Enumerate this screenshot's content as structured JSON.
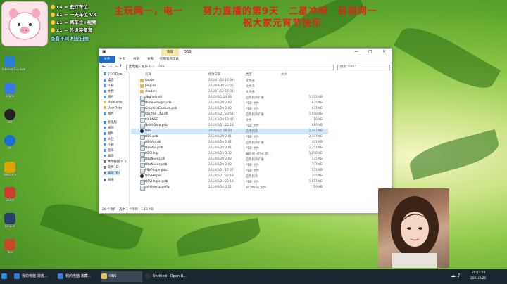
{
  "overlay": {
    "line1": "主玩网一，电一　　努力直播的第9天　二星冲呀　目前网一",
    "line2": "祝大家元宵节快乐",
    "gifts": [
      "x4 = 逛灯车位",
      "x1 = 一天车位 VX",
      "x1 = 两车位+视频",
      "x1 = 外设装备套",
      "查看不同 粉丝日报"
    ]
  },
  "desktop_icons": [
    {
      "label": "Internet Explorer",
      "icon": "ie-icon",
      "color": "#2a7fd4"
    },
    {
      "label": "Sogou",
      "icon": "qq-browser-icon",
      "color": "#3b7bdc"
    },
    {
      "label": "QQ",
      "icon": "qq-penguin-icon",
      "color": "#222222"
    },
    {
      "label": "KK",
      "icon": "k-icon",
      "color": "#1c6fcf"
    },
    {
      "label": "WeGame",
      "icon": "wegame-icon",
      "color": "#d9a400"
    },
    {
      "label": "Game",
      "icon": "game-icon",
      "color": "#c8402e"
    },
    {
      "label": "League",
      "icon": "league-icon",
      "color": "#2a3f6a"
    },
    {
      "label": "Tool",
      "icon": "hand-icon",
      "color": "#c44a2a"
    }
  ],
  "explorer": {
    "title": "OBS",
    "manage_label": "管理",
    "tabs": [
      "文件",
      "主页",
      "共享",
      "查看",
      "应用程序工具"
    ],
    "address": "此电脑 › 娱乐 (E:) › OBS",
    "search_placeholder": "搜索\"OBS\"",
    "columns": [
      "名称",
      "修改日期",
      "类型",
      "大小"
    ],
    "nav": [
      "2345Dow...",
      "桌面",
      "下载",
      "文档",
      "图片",
      "Mobilefile",
      "UserData",
      "图片",
      "此电脑",
      "视频",
      "图片",
      "文档",
      "下载",
      "音乐",
      "桌面",
      "本地磁盘 (C:)",
      "软件 (D:)",
      "娱乐 (E:)",
      "网络"
    ],
    "files": [
      {
        "name": "locale",
        "date": "2018/1/12 16:04",
        "type": "文件夹",
        "size": "",
        "kind": "folder"
      },
      {
        "name": "plugins",
        "date": "2018/8/30 22:07",
        "type": "文件夹",
        "size": "",
        "kind": "folder"
      },
      {
        "name": "shaders",
        "date": "2018/1/12 16:04",
        "type": "文件夹",
        "size": "",
        "kind": "folder"
      },
      {
        "name": "dbghelp.dll",
        "date": "2012/6/1 14:06",
        "type": "应用程序扩展",
        "size": "1,112 KB",
        "kind": "file"
      },
      {
        "name": "DShowPlugin.pdb",
        "date": "2014/6/20 2:02",
        "type": "PDB 文件",
        "size": "875 KB",
        "kind": "file"
      },
      {
        "name": "GraphicsCapture.pdb",
        "date": "2014/6/20 2:02",
        "type": "PDB 文件",
        "size": "691 KB",
        "kind": "file"
      },
      {
        "name": "libx264-142.dll",
        "date": "2014/5/21 23:51",
        "type": "应用程序扩展",
        "size": "1,018 KB",
        "kind": "file"
      },
      {
        "name": "LICENSE",
        "date": "2014/3/28 12:47",
        "type": "文件",
        "size": "18 KB",
        "kind": "file"
      },
      {
        "name": "NoiseGate.pdb",
        "date": "2014/5/21 22:18",
        "type": "PDB 文件",
        "size": "619 KB",
        "kind": "file"
      },
      {
        "name": "OBS",
        "date": "2016/5/1 18:04",
        "type": "应用程序",
        "size": "1,197 KB",
        "kind": "app"
      },
      {
        "name": "OBS.pdb",
        "date": "2014/6/20 2:01",
        "type": "PDB 文件",
        "size": "2,187 KB",
        "kind": "file"
      },
      {
        "name": "OBSApi.dll",
        "date": "2014/6/20 2:01",
        "type": "应用程序扩展",
        "size": "401 KB",
        "kind": "file"
      },
      {
        "name": "OBSApi.pdb",
        "date": "2014/6/20 2:01",
        "type": "PDB 文件",
        "size": "1,251 KB",
        "kind": "file"
      },
      {
        "name": "OBSHelp",
        "date": "2013/6/23 3:32",
        "type": "编译的 HTML 帮...",
        "size": "1,058 KB",
        "kind": "file"
      },
      {
        "name": "ObsNvenc.dll",
        "date": "2014/6/20 2:02",
        "type": "应用程序扩展",
        "size": "135 KB",
        "kind": "file"
      },
      {
        "name": "ObsNvenc.pdb",
        "date": "2014/6/20 2:02",
        "type": "PDB 文件",
        "size": "707 KB",
        "kind": "file"
      },
      {
        "name": "PSVPlugin.pdb",
        "date": "2014/5/21 17:07",
        "type": "PDB 文件",
        "size": "571 KB",
        "kind": "file"
      },
      {
        "name": "QSVHelper",
        "date": "2014/5/21 22:18",
        "type": "应用程序",
        "size": "205 KB",
        "kind": "app"
      },
      {
        "name": "QSVHelper.pdb",
        "date": "2014/5/21 22:18",
        "type": "PDB 文件",
        "size": "1,811 KB",
        "kind": "file"
      },
      {
        "name": "services.xconfig",
        "date": "2014/6/20 0:51",
        "type": "XCONFIG 文件",
        "size": "19 KB",
        "kind": "file"
      }
    ],
    "status": "20 个项目　选中 1 个项目　1.13 MB"
  },
  "taskbar": {
    "items": [
      "我的电脑 浏览...",
      "我的电脑 收藏...",
      "OBS",
      "Untitled - Open B..."
    ],
    "time": "20:11:02",
    "date": "2021/2/26"
  }
}
